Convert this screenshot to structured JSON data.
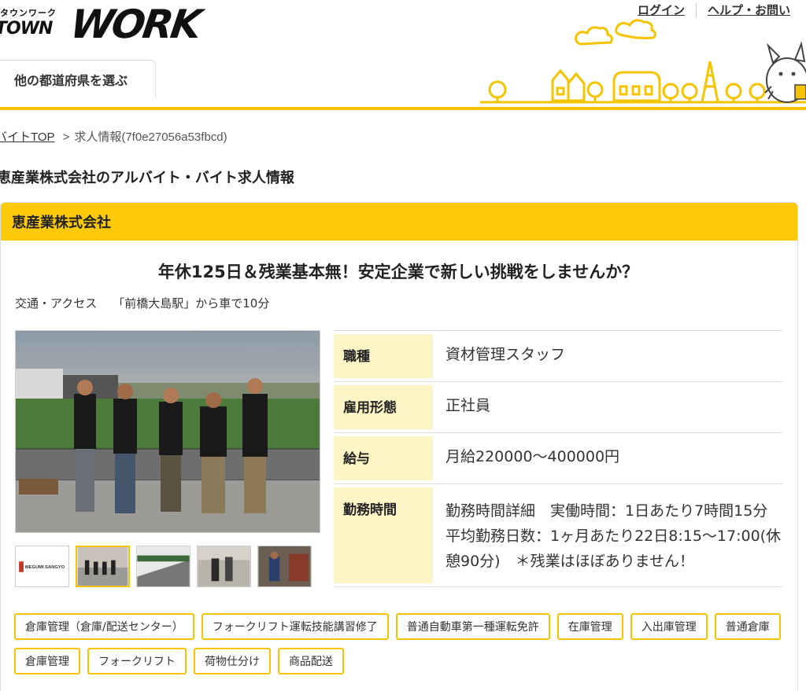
{
  "header": {
    "logo_kana": "タウンワーク",
    "logo_town": "TOWN",
    "logo_work": "WORK",
    "links": [
      "ログイン",
      "ヘルプ・お問い"
    ],
    "prefecture_tab": "他の都道府県を選ぶ"
  },
  "breadcrumb": {
    "home": "バイトTOP",
    "arrow": ">",
    "current": "求人情報(7f0e27056a53fbcd)"
  },
  "page_title": "恵産業株式会社のアルバイト・バイト求人情報",
  "job": {
    "company": "恵産業株式会社",
    "catchcopy": "年休125日＆残業基本無！安定企業で新しい挑戦をしませんか？",
    "access_label": "交通・アクセス",
    "access_value": "「前橋大島駅」から車で10分",
    "details": [
      {
        "label": "職種",
        "value": "資材管理スタッフ"
      },
      {
        "label": "雇用形態",
        "value": "正社員"
      },
      {
        "label": "給与",
        "value": "月給220000～400000円"
      },
      {
        "label": "勤務時間",
        "value": "勤務時間詳細　実働時間：1日あたり7時間15分　平均勤務日数：1ヶ月あたり22日8:15～17:00(休憩90分)　＊残業はほぼありません！"
      }
    ],
    "tags": [
      "倉庫管理（倉庫/配送センター）",
      "フォークリフト運転技能講習修了",
      "普通自動車第一種運転免許",
      "在庫管理",
      "入出庫管理",
      "普通倉庫",
      "倉庫管理",
      "フォークリフト",
      "荷物仕分け",
      "商品配送"
    ],
    "thumb_logo_text": "MEGUMI SANGYO"
  },
  "colors": {
    "accent": "#fdc90a",
    "label_bg": "#fdf5c6",
    "border": "#f5c400"
  }
}
